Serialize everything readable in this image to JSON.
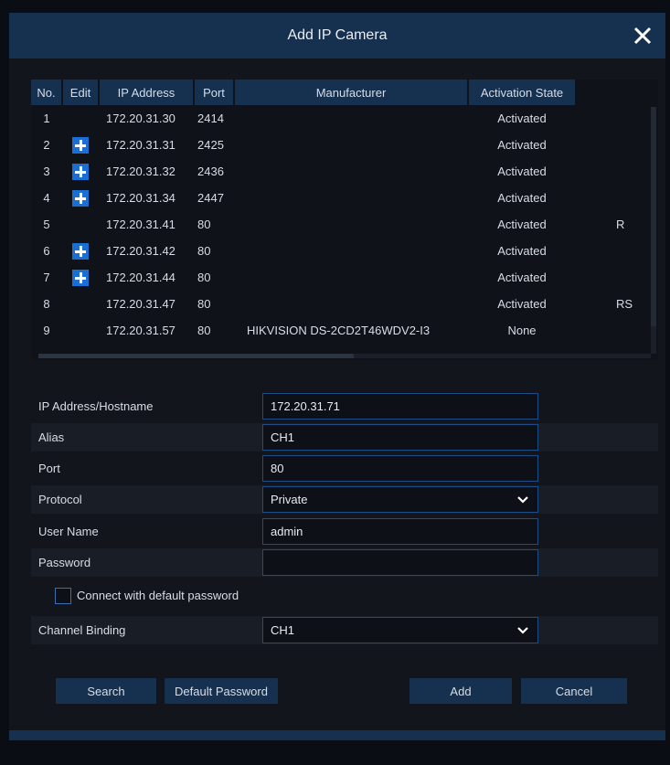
{
  "dialog": {
    "title": "Add IP Camera"
  },
  "table": {
    "columns": [
      "No.",
      "Edit",
      "IP Address",
      "Port",
      "Manufacturer",
      "Activation State",
      ""
    ],
    "rows": [
      {
        "no": "1",
        "edit": false,
        "ip": "172.20.31.30",
        "port": "2414",
        "manufacturer": "",
        "state": "Activated",
        "extra": ""
      },
      {
        "no": "2",
        "edit": true,
        "ip": "172.20.31.31",
        "port": "2425",
        "manufacturer": "",
        "state": "Activated",
        "extra": ""
      },
      {
        "no": "3",
        "edit": true,
        "ip": "172.20.31.32",
        "port": "2436",
        "manufacturer": "",
        "state": "Activated",
        "extra": ""
      },
      {
        "no": "4",
        "edit": true,
        "ip": "172.20.31.34",
        "port": "2447",
        "manufacturer": "",
        "state": "Activated",
        "extra": ""
      },
      {
        "no": "5",
        "edit": false,
        "ip": "172.20.31.41",
        "port": "80",
        "manufacturer": "",
        "state": "Activated",
        "extra": "R"
      },
      {
        "no": "6",
        "edit": true,
        "ip": "172.20.31.42",
        "port": "80",
        "manufacturer": "",
        "state": "Activated",
        "extra": ""
      },
      {
        "no": "7",
        "edit": true,
        "ip": "172.20.31.44",
        "port": "80",
        "manufacturer": "",
        "state": "Activated",
        "extra": ""
      },
      {
        "no": "8",
        "edit": false,
        "ip": "172.20.31.47",
        "port": "80",
        "manufacturer": "",
        "state": "Activated",
        "extra": "RS"
      },
      {
        "no": "9",
        "edit": false,
        "ip": "172.20.31.57",
        "port": "80",
        "manufacturer": "HIKVISION DS-2CD2T46WDV2-I3",
        "state": "None",
        "extra": ""
      }
    ]
  },
  "form": {
    "ip_label": "IP Address/Hostname",
    "ip_value": "172.20.31.71",
    "alias_label": "Alias",
    "alias_value": "CH1",
    "port_label": "Port",
    "port_value": "80",
    "protocol_label": "Protocol",
    "protocol_value": "Private",
    "username_label": "User Name",
    "username_value": "admin",
    "password_label": "Password",
    "password_value": "",
    "default_pw_checkbox_label": "Connect with default password",
    "default_pw_checked": false,
    "channel_label": "Channel Binding",
    "channel_value": "CH1"
  },
  "buttons": {
    "search": "Search",
    "default_password": "Default Password",
    "add": "Add",
    "cancel": "Cancel"
  },
  "icons": {
    "close": "close-icon",
    "add_edit": "plus-icon",
    "dropdown": "chevron-down-icon"
  },
  "colors": {
    "accent": "#1b6fd2",
    "header": "#16304f",
    "background": "#12151c"
  }
}
